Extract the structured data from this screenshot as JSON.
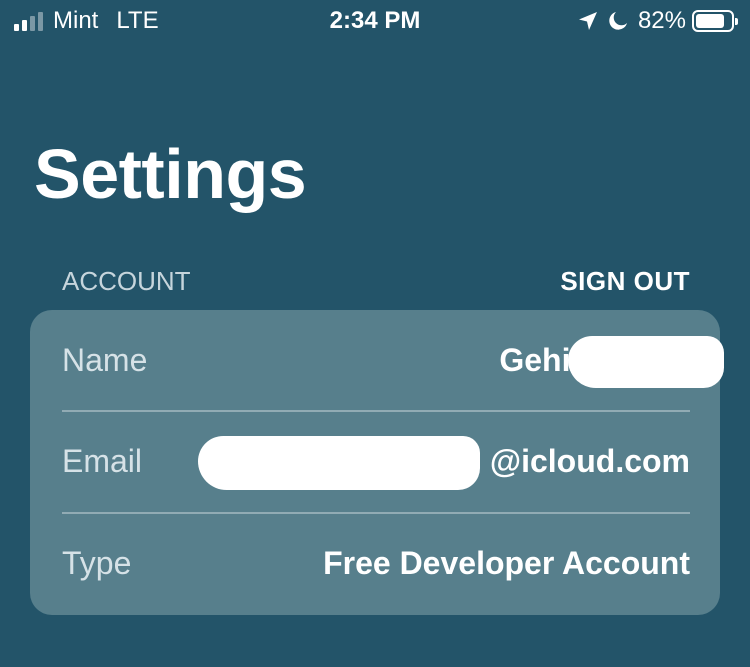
{
  "status_bar": {
    "carrier": "Mint",
    "network": "LTE",
    "time": "2:34 PM",
    "battery_percent": "82%",
    "icons": [
      "signal-icon",
      "location-arrow-icon",
      "moon-icon",
      "battery-icon"
    ]
  },
  "page": {
    "title": "Settings"
  },
  "account_section": {
    "header": "ACCOUNT",
    "sign_out_label": "SIGN OUT",
    "rows": [
      {
        "label": "Name",
        "value": "Gehig"
      },
      {
        "label": "Email",
        "value": "@icloud.com"
      },
      {
        "label": "Type",
        "value": "Free Developer Account"
      }
    ]
  },
  "colors": {
    "background": "#235469",
    "card": "#577f8c",
    "text": "#ffffff"
  }
}
